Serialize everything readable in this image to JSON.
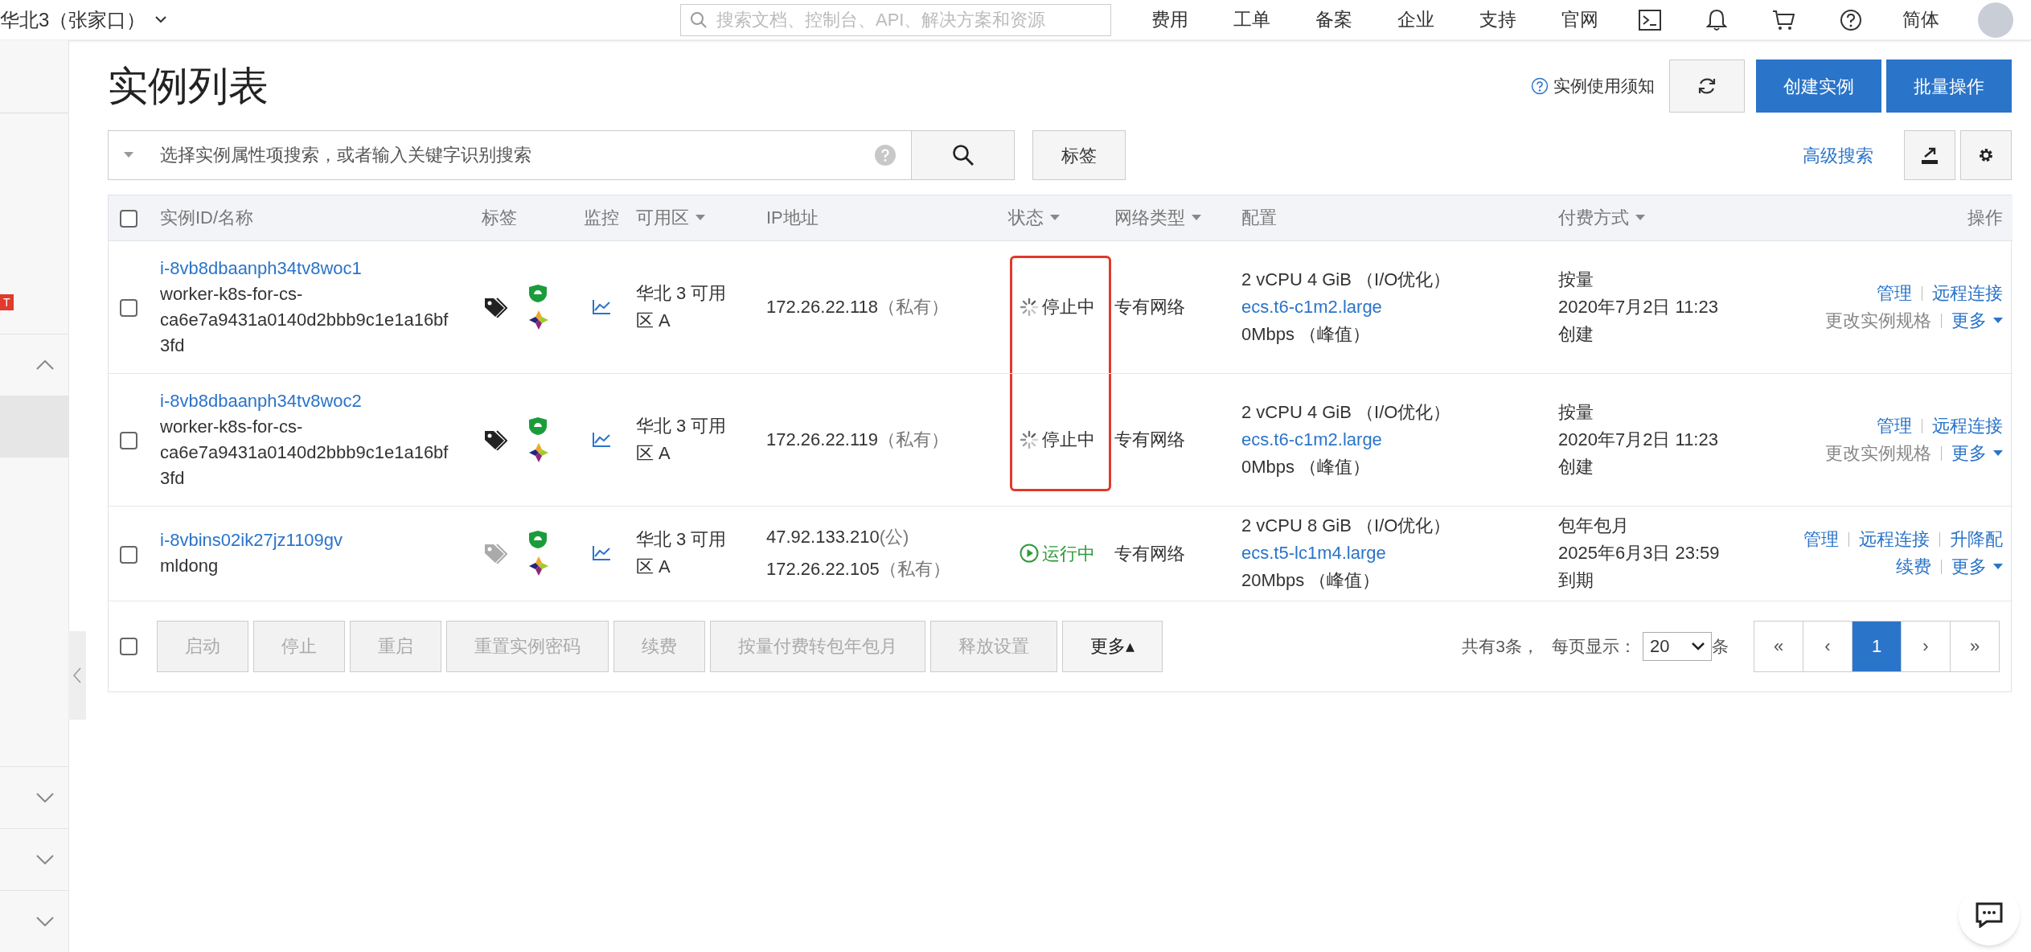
{
  "topbar": {
    "region": "华北3（张家口）",
    "search": {
      "placeholder": "搜索文档、控制台、API、解决方案和资源"
    },
    "nav": [
      "费用",
      "工单",
      "备案",
      "企业",
      "支持",
      "官网"
    ],
    "language": "简体"
  },
  "sidebar": {
    "badge": "T",
    "items": [
      {
        "kind": "expand",
        "expanded": true,
        "selected": false
      },
      {
        "kind": "item",
        "selected": true
      },
      {
        "kind": "expand",
        "expanded": false,
        "selected": false
      },
      {
        "kind": "expand",
        "expanded": false,
        "selected": false
      },
      {
        "kind": "expand",
        "expanded": false,
        "selected": false
      }
    ]
  },
  "page": {
    "title": "实例列表",
    "notice_link": "实例使用须知",
    "buttons": [
      "创建实例",
      "批量操作"
    ]
  },
  "filter": {
    "placeholder": "选择实例属性项搜索，或者输入关键字识别搜索",
    "tag_button": "标签",
    "advanced_search": "高级搜索"
  },
  "table": {
    "select_all": {
      "checked": false
    },
    "columns": [
      {
        "label": "实例ID/名称",
        "sortable": false
      },
      {
        "label": "标签",
        "sortable": false
      },
      {
        "label": "监控",
        "sortable": false
      },
      {
        "label": "可用区",
        "sortable": true
      },
      {
        "label": "IP地址",
        "sortable": false
      },
      {
        "label": "状态",
        "sortable": true
      },
      {
        "label": "网络类型",
        "sortable": true
      },
      {
        "label": "配置",
        "sortable": false
      },
      {
        "label": "付费方式",
        "sortable": true
      },
      {
        "label": "操作",
        "sortable": false
      }
    ],
    "rows": [
      {
        "checked": false,
        "id": "i-8vb8dbaanph34tv8woc1",
        "name": "worker-k8s-for-cs-ca6e7a9431a0140d2bbb9c1e1a16bf3fd",
        "has_tags": true,
        "zone": "华北 3 可用区 A",
        "ips": [
          {
            "address": "172.26.22.118",
            "type": "（私有）"
          }
        ],
        "status": {
          "kind": "stopping",
          "label": "停止中"
        },
        "highlighted": true,
        "network": "专有网络",
        "spec": "2 vCPU 4 GiB （I/O优化）",
        "instance_type": "ecs.t6-c1m2.large",
        "bandwidth": "0Mbps （峰值）",
        "billing": "按量",
        "billing_time": "2020年7月2日 11:23",
        "billing_note": "创建",
        "actions": [
          [
            {
              "label": "管理",
              "disabled": false,
              "caret": false
            },
            {
              "label": "远程连接",
              "disabled": false,
              "caret": false
            }
          ],
          [
            {
              "label": "更改实例规格",
              "disabled": true,
              "caret": false
            },
            {
              "label": "更多",
              "disabled": false,
              "caret": true
            }
          ]
        ]
      },
      {
        "checked": false,
        "id": "i-8vb8dbaanph34tv8woc2",
        "name": "worker-k8s-for-cs-ca6e7a9431a0140d2bbb9c1e1a16bf3fd",
        "has_tags": true,
        "zone": "华北 3 可用区 A",
        "ips": [
          {
            "address": "172.26.22.119",
            "type": "（私有）"
          }
        ],
        "status": {
          "kind": "stopping",
          "label": "停止中"
        },
        "highlighted": true,
        "network": "专有网络",
        "spec": "2 vCPU 4 GiB （I/O优化）",
        "instance_type": "ecs.t6-c1m2.large",
        "bandwidth": "0Mbps （峰值）",
        "billing": "按量",
        "billing_time": "2020年7月2日 11:23",
        "billing_note": "创建",
        "actions": [
          [
            {
              "label": "管理",
              "disabled": false,
              "caret": false
            },
            {
              "label": "远程连接",
              "disabled": false,
              "caret": false
            }
          ],
          [
            {
              "label": "更改实例规格",
              "disabled": true,
              "caret": false
            },
            {
              "label": "更多",
              "disabled": false,
              "caret": true
            }
          ]
        ]
      },
      {
        "checked": false,
        "id": "i-8vbins02ik27jz1109gv",
        "name": "mldong",
        "has_tags": false,
        "zone": "华北 3 可用区 A",
        "ips": [
          {
            "address": "47.92.133.210",
            "type": "(公)"
          },
          {
            "address": "172.26.22.105",
            "type": "（私有）"
          }
        ],
        "status": {
          "kind": "running",
          "label": "运行中"
        },
        "highlighted": false,
        "network": "专有网络",
        "spec": "2 vCPU 8 GiB （I/O优化）",
        "instance_type": "ecs.t5-lc1m4.large",
        "bandwidth": "20Mbps （峰值）",
        "billing": "包年包月",
        "billing_time": "2025年6月3日 23:59",
        "billing_note": "到期",
        "actions": [
          [
            {
              "label": "管理",
              "disabled": false,
              "caret": false
            },
            {
              "label": "远程连接",
              "disabled": false,
              "caret": false
            },
            {
              "label": "升降配",
              "disabled": false,
              "caret": false
            }
          ],
          [
            {
              "label": "续费",
              "disabled": false,
              "caret": false
            },
            {
              "label": "更多",
              "disabled": false,
              "caret": true
            }
          ]
        ]
      }
    ]
  },
  "footer": {
    "select_all": {
      "checked": false
    },
    "buttons": [
      {
        "label": "启动",
        "disabled": true
      },
      {
        "label": "停止",
        "disabled": true
      },
      {
        "label": "重启",
        "disabled": true
      },
      {
        "label": "重置实例密码",
        "disabled": true
      },
      {
        "label": "续费",
        "disabled": true
      },
      {
        "label": "按量付费转包年包月",
        "disabled": true
      },
      {
        "label": "释放设置",
        "disabled": true
      },
      {
        "label": "更多▴",
        "disabled": false
      }
    ],
    "total": "共有3条，",
    "page_size_label": "每页显示：",
    "page_size": "20",
    "page_size_unit": "条",
    "pages": [
      {
        "label": "«",
        "selected": false
      },
      {
        "label": "‹",
        "selected": false
      },
      {
        "label": "1",
        "selected": true
      },
      {
        "label": "›",
        "selected": false
      },
      {
        "label": "»",
        "selected": false
      }
    ]
  }
}
